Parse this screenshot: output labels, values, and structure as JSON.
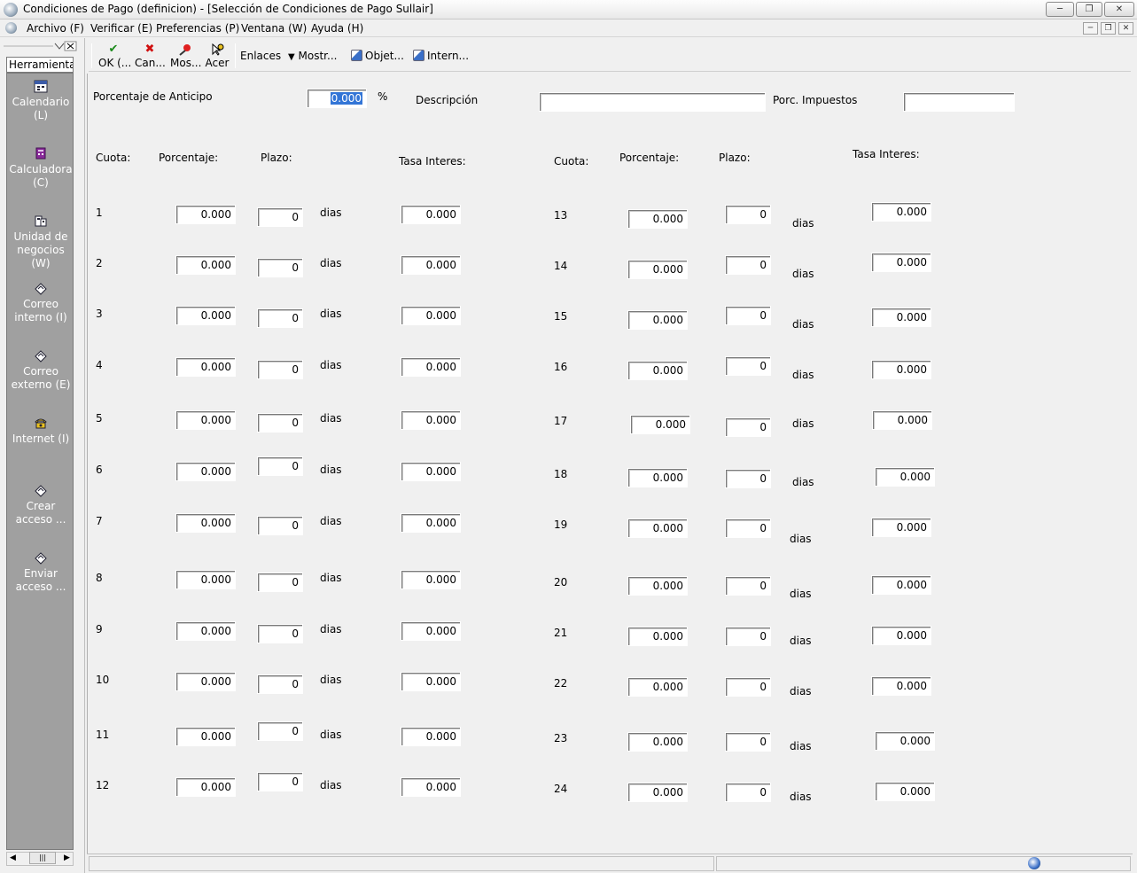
{
  "window": {
    "title": "Condiciones de Pago (definicion) - [Selección de Condiciones de Pago Sullair]"
  },
  "menu": {
    "items": [
      "Archivo (F)",
      "Verificar (E)",
      "Preferencias (P)",
      "Ventana (W)",
      "Ayuda (H)"
    ]
  },
  "sidebar": {
    "tab_label": "Herramienta",
    "items": [
      {
        "label1": "Calendario",
        "label2": "(L)",
        "icon": "calendar-icon"
      },
      {
        "label1": "Calculadora",
        "label2": "(C)",
        "icon": "calculator-icon"
      },
      {
        "label1": "Unidad de",
        "label2": "negocios (W)",
        "icon": "business-unit-icon"
      },
      {
        "label1": "Correo",
        "label2": "interno (I)",
        "icon": "internal-mail-icon"
      },
      {
        "label1": "Correo",
        "label2": "externo (E)",
        "icon": "external-mail-icon"
      },
      {
        "label1": "Internet (I)",
        "label2": "",
        "icon": "phone-icon"
      },
      {
        "label1": "Crear",
        "label2": "acceso ...",
        "icon": "create-access-icon"
      },
      {
        "label1": "Enviar",
        "label2": "acceso ...",
        "icon": "send-access-icon"
      }
    ]
  },
  "toolbar": {
    "ok": "OK (...",
    "cancel": "Can...",
    "show": "Mos...",
    "about": "Acer",
    "links": "Enlaces",
    "mostrar": "Mostr...",
    "objects": "Objet...",
    "internet": "Intern..."
  },
  "header": {
    "anticipo_label": "Porcentaje de Anticipo",
    "anticipo_value": "0.000",
    "percent_sign": "%",
    "descripcion_label": "Descripción",
    "descripcion_value": "",
    "impuestos_label": "Porc. Impuestos",
    "impuestos_value": ""
  },
  "columns": {
    "cuota": "Cuota:",
    "porcentaje": "Porcentaje:",
    "plazo": "Plazo:",
    "tasa": "Tasa Interes:",
    "unit": "dias"
  },
  "cuotas_left": [
    {
      "n": "1",
      "porcentaje": "0.000",
      "plazo": "0",
      "tasa": "0.000"
    },
    {
      "n": "2",
      "porcentaje": "0.000",
      "plazo": "0",
      "tasa": "0.000"
    },
    {
      "n": "3",
      "porcentaje": "0.000",
      "plazo": "0",
      "tasa": "0.000"
    },
    {
      "n": "4",
      "porcentaje": "0.000",
      "plazo": "0",
      "tasa": "0.000"
    },
    {
      "n": "5",
      "porcentaje": "0.000",
      "plazo": "0",
      "tasa": "0.000"
    },
    {
      "n": "6",
      "porcentaje": "0.000",
      "plazo": "0",
      "tasa": "0.000"
    },
    {
      "n": "7",
      "porcentaje": "0.000",
      "plazo": "0",
      "tasa": "0.000"
    },
    {
      "n": "8",
      "porcentaje": "0.000",
      "plazo": "0",
      "tasa": "0.000"
    },
    {
      "n": "9",
      "porcentaje": "0.000",
      "plazo": "0",
      "tasa": "0.000"
    },
    {
      "n": "10",
      "porcentaje": "0.000",
      "plazo": "0",
      "tasa": "0.000"
    },
    {
      "n": "11",
      "porcentaje": "0.000",
      "plazo": "0",
      "tasa": "0.000"
    },
    {
      "n": "12",
      "porcentaje": "0.000",
      "plazo": "0",
      "tasa": "0.000"
    }
  ],
  "cuotas_right": [
    {
      "n": "13",
      "porcentaje": "0.000",
      "plazo": "0",
      "tasa": "0.000"
    },
    {
      "n": "14",
      "porcentaje": "0.000",
      "plazo": "0",
      "tasa": "0.000"
    },
    {
      "n": "15",
      "porcentaje": "0.000",
      "plazo": "0",
      "tasa": "0.000"
    },
    {
      "n": "16",
      "porcentaje": "0.000",
      "plazo": "0",
      "tasa": "0.000"
    },
    {
      "n": "17",
      "porcentaje": "0.000",
      "plazo": "0",
      "tasa": "0.000"
    },
    {
      "n": "18",
      "porcentaje": "0.000",
      "plazo": "0",
      "tasa": "0.000"
    },
    {
      "n": "19",
      "porcentaje": "0.000",
      "plazo": "0",
      "tasa": "0.000"
    },
    {
      "n": "20",
      "porcentaje": "0.000",
      "plazo": "0",
      "tasa": "0.000"
    },
    {
      "n": "21",
      "porcentaje": "0.000",
      "plazo": "0",
      "tasa": "0.000"
    },
    {
      "n": "22",
      "porcentaje": "0.000",
      "plazo": "0",
      "tasa": "0.000"
    },
    {
      "n": "23",
      "porcentaje": "0.000",
      "plazo": "0",
      "tasa": "0.000"
    },
    {
      "n": "24",
      "porcentaje": "0.000",
      "plazo": "0",
      "tasa": "0.000"
    }
  ],
  "colors": {
    "sidebar_bg": "#a0a0a0",
    "selection": "#3375d6",
    "window_bg": "#f0f0f0"
  }
}
